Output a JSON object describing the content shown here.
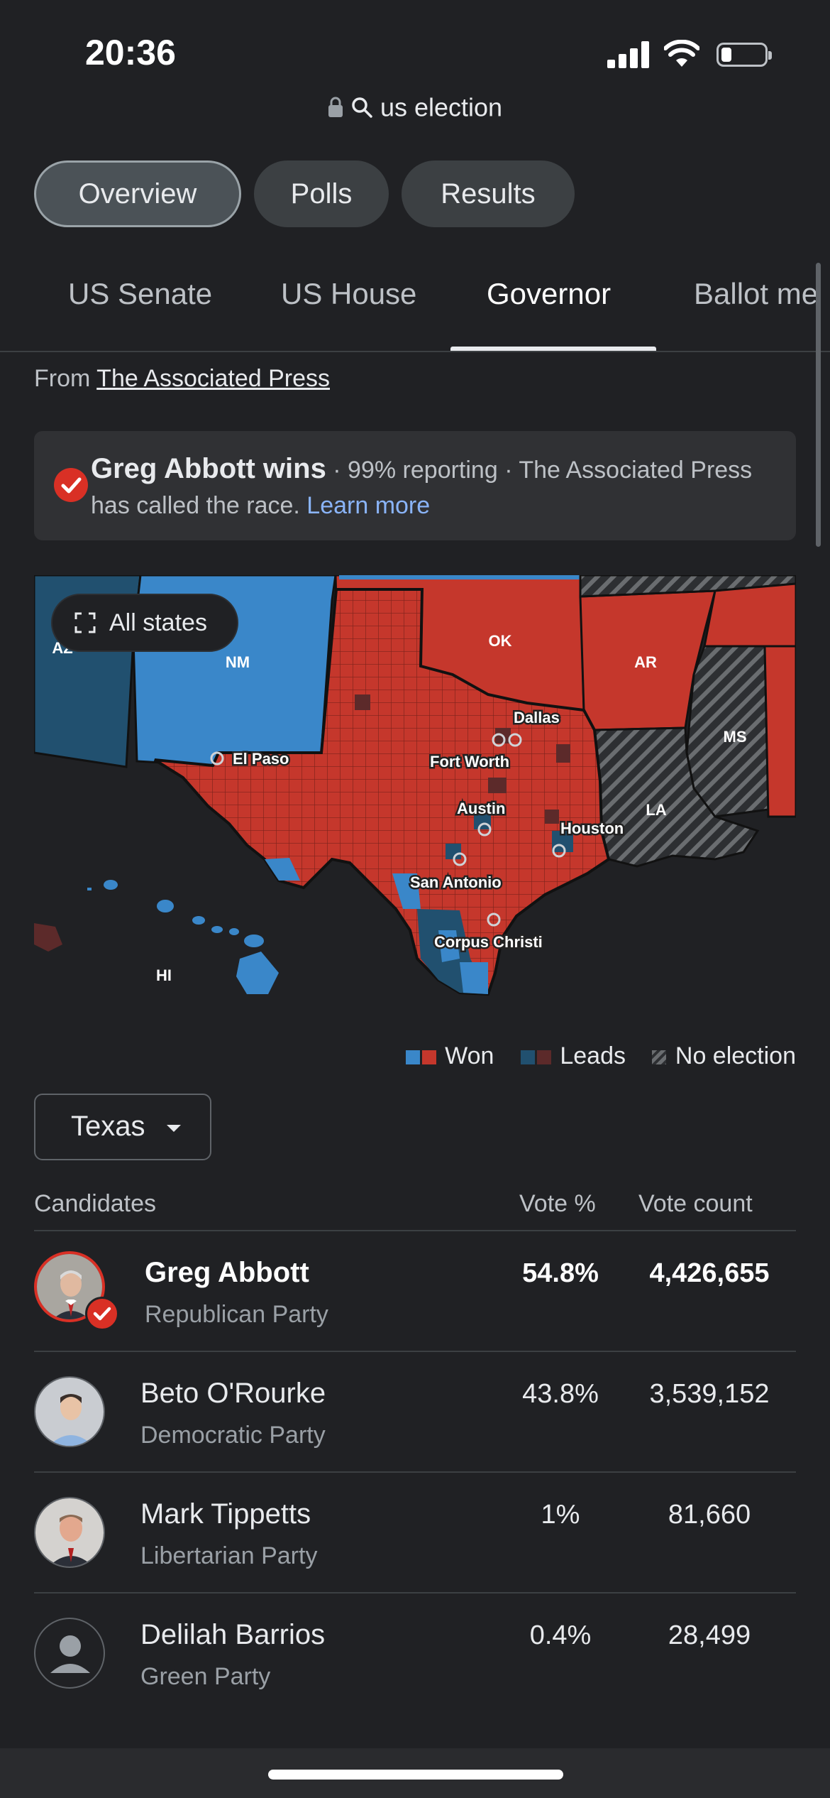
{
  "status": {
    "time": "20:36"
  },
  "url": {
    "query": "us election"
  },
  "chips": [
    {
      "label": "Overview",
      "active": true
    },
    {
      "label": "Polls"
    },
    {
      "label": "Results"
    }
  ],
  "tabs": [
    {
      "label": "US Senate"
    },
    {
      "label": "US House"
    },
    {
      "label": "Governor",
      "active": true
    },
    {
      "label": "Ballot me"
    }
  ],
  "source": {
    "prefix": "From",
    "name": "The Associated Press"
  },
  "banner": {
    "headline": "Greg Abbott wins",
    "detail": " · 99% reporting · The Associated Press has called the race. ",
    "link": "Learn more"
  },
  "map": {
    "button": "All states",
    "state_labels": {
      "nm": "NM",
      "ok": "OK",
      "ar": "AR",
      "ms": "MS",
      "la": "LA",
      "hi": "HI",
      "az": "AZ"
    },
    "cities": [
      "El Paso",
      "Dallas",
      "Fort Worth",
      "Austin",
      "Houston",
      "San Antonio",
      "Corpus Christi"
    ],
    "colors": {
      "rep": "#c5372c",
      "rep_lead": "#5c2a2a",
      "dem": "#3a87c9",
      "dem_lead": "#21506f"
    }
  },
  "legend": {
    "won": "Won",
    "leads": "Leads",
    "no_election": "No election"
  },
  "state_select": {
    "value": "Texas"
  },
  "table": {
    "headers": {
      "candidates": "Candidates",
      "vote_pct": "Vote %",
      "vote_count": "Vote count"
    },
    "rows": [
      {
        "name": "Greg Abbott",
        "party": "Republican Party",
        "pct": "54.8%",
        "count": "4,426,655",
        "winner": true
      },
      {
        "name": "Beto O'Rourke",
        "party": "Democratic Party",
        "pct": "43.8%",
        "count": "3,539,152"
      },
      {
        "name": "Mark Tippetts",
        "party": "Libertarian Party",
        "pct": "1%",
        "count": "81,660"
      },
      {
        "name": "Delilah Barrios",
        "party": "Green Party",
        "pct": "0.4%",
        "count": "28,499"
      }
    ]
  }
}
